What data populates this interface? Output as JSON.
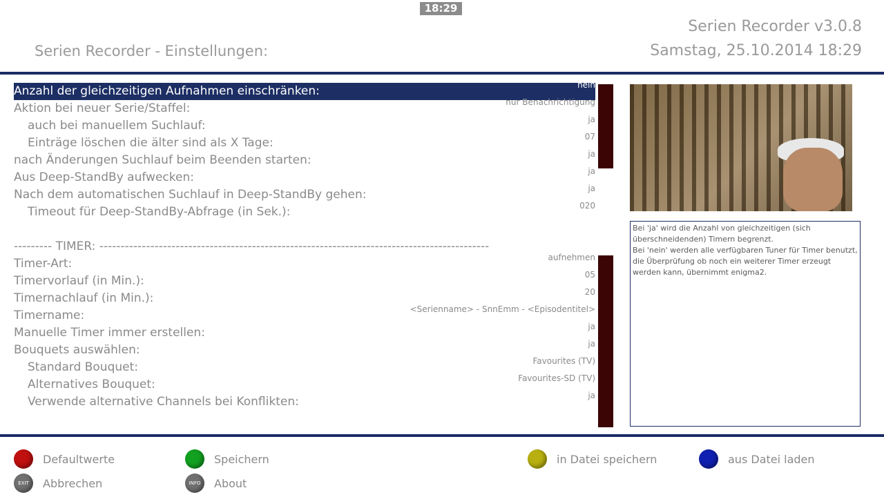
{
  "header": {
    "clock": "18:29",
    "title": "Serien Recorder - Einstellungen:",
    "version": "Serien Recorder v3.0.8",
    "datetime": "Samstag, 25.10.2014  18:29"
  },
  "settings": [
    {
      "label": "Anzahl der gleichzeitigen Aufnahmen einschränken:",
      "value": "nein",
      "selected": true
    },
    {
      "label": "Aktion bei neuer Serie/Staffel:",
      "value": "nur Benachrichtigung"
    },
    {
      "label": "auch bei manuellem Suchlauf:",
      "value": "ja",
      "indent": true
    },
    {
      "label": "Einträge löschen die älter sind als X Tage:",
      "value": "07",
      "indent": true
    },
    {
      "label": "nach Änderungen Suchlauf beim Beenden starten:",
      "value": "ja"
    },
    {
      "label": "Aus Deep-StandBy aufwecken:",
      "value": "ja"
    },
    {
      "label": "Nach dem automatischen Suchlauf in Deep-StandBy gehen:",
      "value": "ja"
    },
    {
      "label": "Timeout für Deep-StandBy-Abfrage (in Sek.):",
      "value": "020",
      "indent": true
    },
    {
      "label": "",
      "value": "",
      "blank": true
    },
    {
      "label": "---------  TIMER: --------------------------------------------------------------------------------------------",
      "value": ""
    },
    {
      "label": "Timer-Art:",
      "value": "aufnehmen"
    },
    {
      "label": "Timervorlauf (in Min.):",
      "value": "05"
    },
    {
      "label": "Timernachlauf (in Min.):",
      "value": "20"
    },
    {
      "label": "Timername:",
      "value": "<Serienname> - SnnEmm - <Episodentitel>"
    },
    {
      "label": "Manuelle Timer immer erstellen:",
      "value": "ja"
    },
    {
      "label": "Bouquets auswählen:",
      "value": "ja"
    },
    {
      "label": "Standard Bouquet:",
      "value": "Favourites (TV)",
      "indent": true
    },
    {
      "label": "Alternatives Bouquet:",
      "value": "Favourites-SD (TV)",
      "indent": true
    },
    {
      "label": "Verwende alternative Channels bei Konflikten:",
      "value": "ja",
      "indent": true
    }
  ],
  "help_text": "Bei 'ja' wird die Anzahl von gleichzeitigen (sich überschneidenden) Timern begrenzt.\nBei 'nein' werden alle verfügbaren Tuner für Timer benutzt, die Überprüfung ob noch ein weiterer Timer erzeugt werden kann, übernimmt enigma2.",
  "buttons": {
    "red": {
      "label": "Defaultwerte",
      "icon": "red-button-icon"
    },
    "green": {
      "label": "Speichern",
      "icon": "green-button-icon"
    },
    "yellow": {
      "label": "in Datei speichern",
      "icon": "yellow-button-icon"
    },
    "blue": {
      "label": "aus Datei laden",
      "icon": "blue-button-icon"
    },
    "exit": {
      "label": "Abbrechen",
      "icon": "exit-button-icon",
      "icon_text": "EXIT"
    },
    "info": {
      "label": "About",
      "icon": "info-button-icon",
      "icon_text": "INFO"
    }
  },
  "colors": {
    "accent": "#1c2e63",
    "scrollbar": "#3c0505",
    "red": "#c01010",
    "green": "#12a020",
    "yellow": "#b8b010",
    "blue": "#1020b0"
  }
}
